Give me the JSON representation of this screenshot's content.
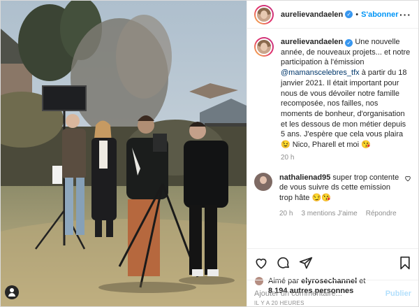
{
  "header": {
    "username": "aurelievandaelen",
    "separator": "•",
    "follow_label": "S'abonner",
    "more_label": "···"
  },
  "caption": {
    "username": "aurelievandaelen",
    "text_before_mention": " Une nouvelle année, de nouveaux projets...\net notre participation à l'émission ",
    "mention": "@mamanscelebres_tfx",
    "text_after_mention": " à partir du 18 janvier 2021. Il était important pour nous de vous dévoiler notre famille recomposée, nos failles, nos moments de bonheur, d'organisation et les dessous de mon métier depuis 5 ans. J'espère que cela vous plaira 😉 Nico, Pharell et moi 😘",
    "time": "20 h"
  },
  "comment": {
    "username": "nathalienad95",
    "text": " super trop contente de vous suivre ds cette emission trop hâte 😏😘",
    "time": "20 h",
    "likes": "3 mentions J'aime",
    "reply": "Répondre"
  },
  "likes": {
    "prefix": "Aimé par ",
    "user": "elyrosechannel",
    "middle": " et",
    "others": "8 194 autres personnes"
  },
  "timestamp": "IL Y A 20 HEURES",
  "add_comment": {
    "placeholder": "Ajouter un commentaire...",
    "publish_label": "Publier"
  },
  "colors": {
    "accent": "#0095f6",
    "verified": "#3897f0",
    "muted": "#8e8e8e",
    "publish_disabled": "#b2dffc"
  }
}
